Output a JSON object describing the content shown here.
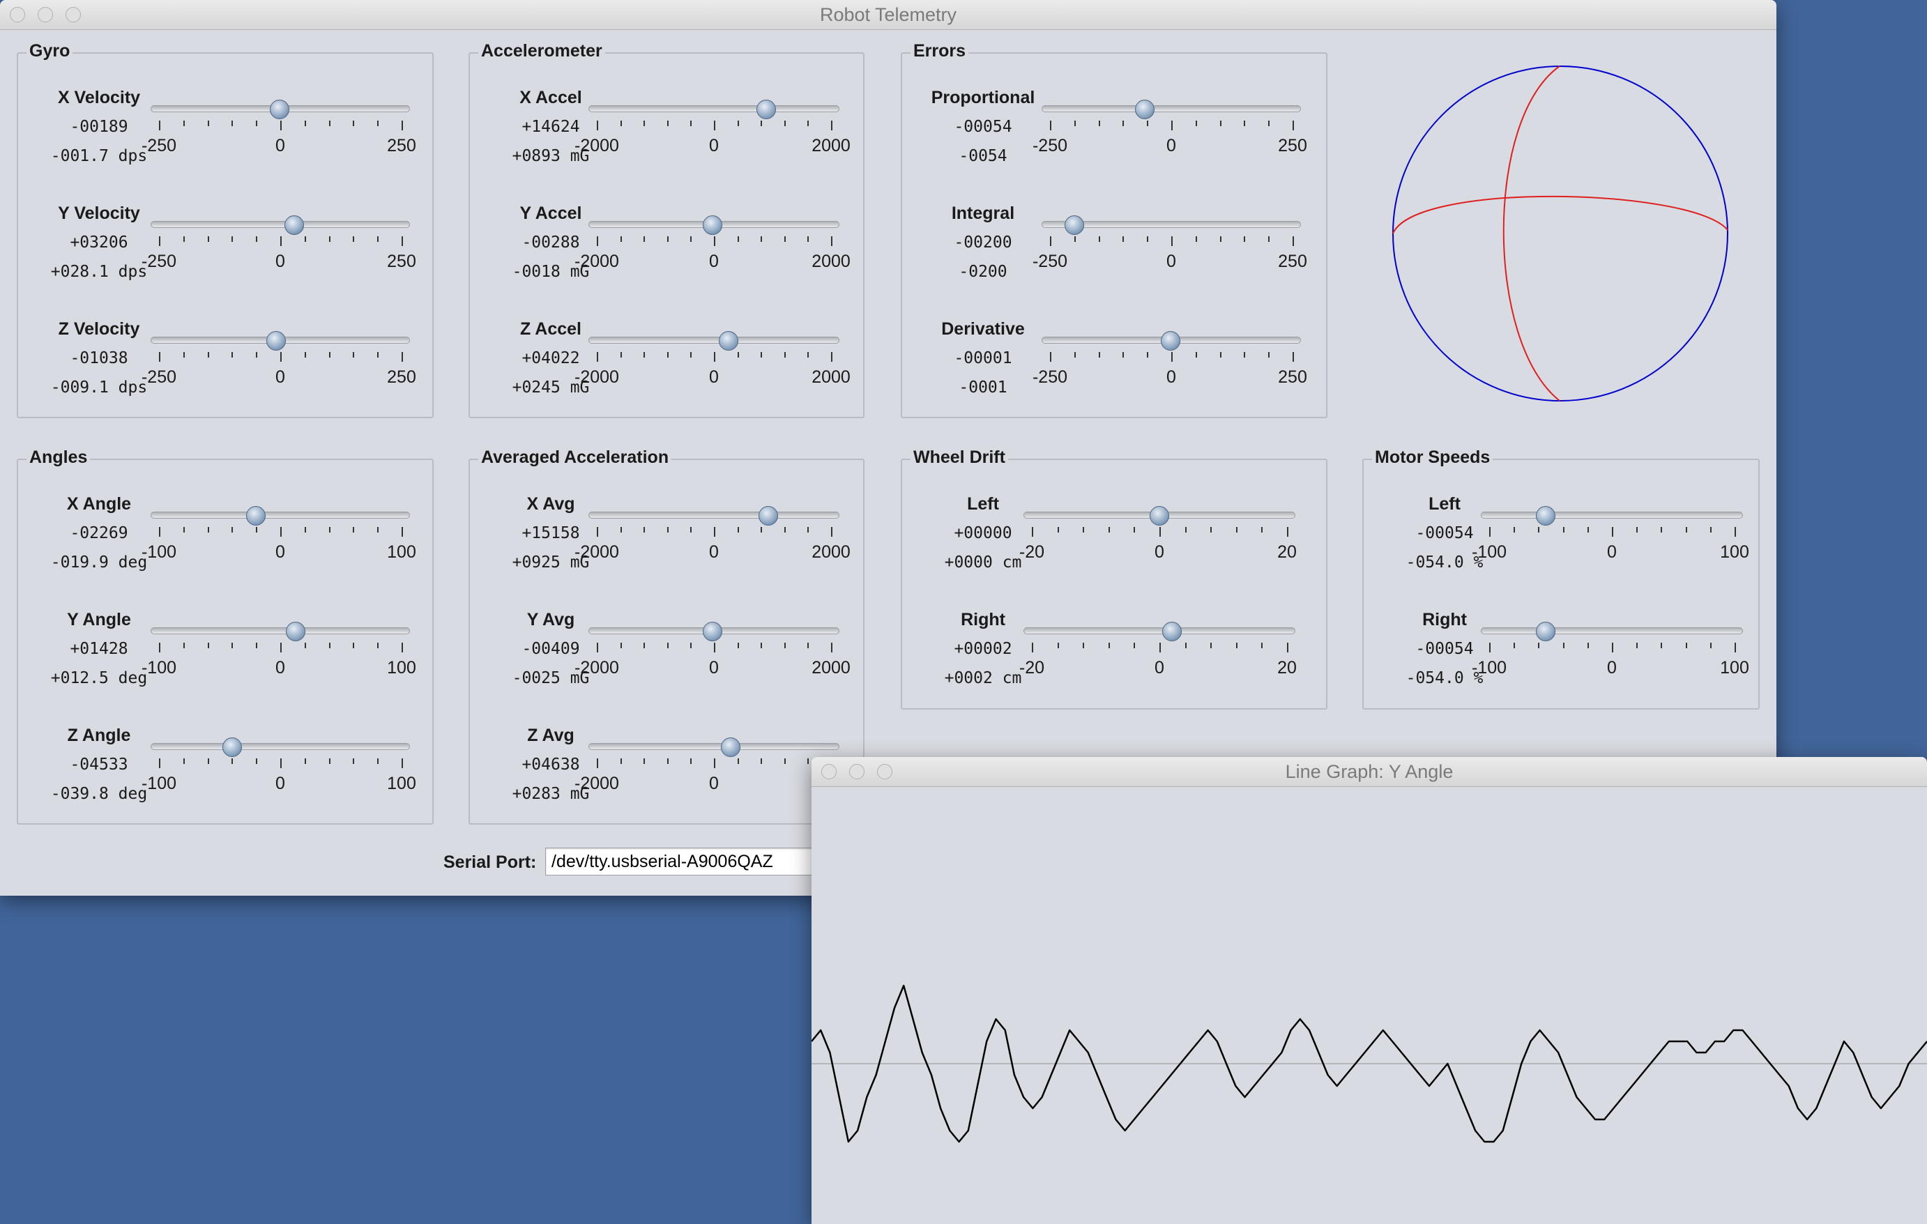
{
  "main_window": {
    "title": "Robot Telemetry",
    "serial_port_label": "Serial Port:",
    "serial_port_value": "/dev/tty.usbserial-A9006QAZ"
  },
  "graph_window": {
    "title": "Line Graph: Y Angle"
  },
  "panels": [
    {
      "title": "Gyro",
      "scale": [
        "-250",
        "0",
        "250"
      ],
      "min": -250,
      "max": 250,
      "rows": [
        {
          "label": "X Velocity",
          "raw": "-00189",
          "value": "-001.7 dps",
          "position": -1.7
        },
        {
          "label": "Y Velocity",
          "raw": "+03206",
          "value": "+028.1 dps",
          "position": 28.1
        },
        {
          "label": "Z Velocity",
          "raw": "-01038",
          "value": "-009.1 dps",
          "position": -9.1
        }
      ]
    },
    {
      "title": "Accelerometer",
      "scale": [
        "-2000",
        "0",
        "2000"
      ],
      "min": -2000,
      "max": 2000,
      "rows": [
        {
          "label": "X Accel",
          "raw": "+14624",
          "value": "+0893 mG",
          "position": 893
        },
        {
          "label": "Y Accel",
          "raw": "-00288",
          "value": "-0018 mG",
          "position": -18
        },
        {
          "label": "Z Accel",
          "raw": "+04022",
          "value": "+0245 mG",
          "position": 245
        }
      ]
    },
    {
      "title": "Errors",
      "scale": [
        "-250",
        "0",
        "250"
      ],
      "min": -250,
      "max": 250,
      "rows": [
        {
          "label": "Proportional",
          "raw": "-00054",
          "value": "-0054",
          "position": -54
        },
        {
          "label": "Integral",
          "raw": "-00200",
          "value": "-0200",
          "position": -200
        },
        {
          "label": "Derivative",
          "raw": "-00001",
          "value": "-0001",
          "position": -1
        }
      ]
    },
    {
      "title": "Angles",
      "scale": [
        "-100",
        "0",
        "100"
      ],
      "min": -100,
      "max": 100,
      "rows": [
        {
          "label": "X Angle",
          "raw": "-02269",
          "value": "-019.9 deg",
          "position": -19.9
        },
        {
          "label": "Y Angle",
          "raw": "+01428",
          "value": "+012.5 deg",
          "position": 12.5
        },
        {
          "label": "Z Angle",
          "raw": "-04533",
          "value": "-039.8 deg",
          "position": -39.8
        }
      ]
    },
    {
      "title": "Averaged Acceleration",
      "scale": [
        "-2000",
        "0",
        "2000"
      ],
      "min": -2000,
      "max": 2000,
      "rows": [
        {
          "label": "X Avg",
          "raw": "+15158",
          "value": "+0925 mG",
          "position": 925
        },
        {
          "label": "Y Avg",
          "raw": "-00409",
          "value": "-0025 mG",
          "position": -25
        },
        {
          "label": "Z Avg",
          "raw": "+04638",
          "value": "+0283 mG",
          "position": 283
        }
      ]
    },
    {
      "title": "Wheel Drift",
      "scale": [
        "-20",
        "0",
        "20"
      ],
      "min": -20,
      "max": 20,
      "rows": [
        {
          "label": "Left",
          "raw": "+00000",
          "value": "+0000 cm",
          "position": 0
        },
        {
          "label": "Right",
          "raw": "+00002",
          "value": "+0002 cm",
          "position": 2
        }
      ]
    },
    {
      "title": "Motor Speeds",
      "scale": [
        "-100",
        "0",
        "100"
      ],
      "min": -100,
      "max": 100,
      "rows": [
        {
          "label": "Left",
          "raw": "-00054",
          "value": "-054.0 %",
          "position": -54
        },
        {
          "label": "Right",
          "raw": "-00054",
          "value": "-054.0 %",
          "position": -54
        }
      ]
    }
  ],
  "colors": {
    "sphere_outline": "#0000d0",
    "sphere_lines": "#e02020",
    "graph_line": "#000000"
  },
  "chart_data": {
    "type": "line",
    "title": "Line Graph: Y Angle",
    "x": [
      0,
      1,
      2,
      3,
      4,
      5,
      6,
      7,
      8,
      9,
      10,
      11,
      12,
      13,
      14,
      15,
      16,
      17,
      18,
      19,
      20,
      21,
      22,
      23,
      24,
      25,
      26,
      27,
      28,
      29,
      30,
      31,
      32,
      33,
      34,
      35,
      36,
      37,
      38,
      39,
      40,
      41,
      42,
      43,
      44,
      45,
      46,
      47,
      48,
      49,
      50,
      51,
      52,
      53,
      54,
      55,
      56,
      57,
      58,
      59,
      60,
      61,
      62,
      63,
      64,
      65,
      66,
      67,
      68,
      69,
      70,
      71,
      72,
      73,
      74,
      75,
      76,
      77,
      78,
      79,
      80,
      81,
      82,
      83,
      84,
      85,
      86,
      87,
      88,
      89,
      90,
      91,
      92,
      93,
      94,
      95,
      96,
      97,
      98,
      99,
      100,
      101,
      102,
      103,
      104,
      105,
      106,
      107,
      108,
      109,
      110,
      111,
      112,
      113,
      114,
      115,
      116,
      117,
      118,
      119
    ],
    "values": [
      2,
      3,
      1,
      -3,
      -7,
      -6,
      -3,
      -1,
      2,
      5,
      7,
      4,
      1,
      -1,
      -4,
      -6,
      -7,
      -6,
      -2,
      2,
      4,
      3,
      -1,
      -3,
      -4,
      -3,
      -1,
      1,
      3,
      2,
      1,
      -1,
      -3,
      -5,
      -6,
      -5,
      -4,
      -3,
      -2,
      -1,
      0,
      1,
      2,
      3,
      2,
      0,
      -2,
      -3,
      -2,
      -1,
      0,
      1,
      3,
      4,
      3,
      1,
      -1,
      -2,
      -1,
      0,
      1,
      2,
      3,
      2,
      1,
      0,
      -1,
      -2,
      -1,
      0,
      -2,
      -4,
      -6,
      -7,
      -7,
      -6,
      -3,
      0,
      2,
      3,
      2,
      1,
      -1,
      -3,
      -4,
      -5,
      -5,
      -4,
      -3,
      -2,
      -1,
      0,
      1,
      2,
      2,
      2,
      1,
      1,
      2,
      2,
      3,
      3,
      2,
      1,
      0,
      -1,
      -2,
      -4,
      -5,
      -4,
      -2,
      0,
      2,
      1,
      -1,
      -3,
      -4,
      -3,
      -2,
      0,
      1,
      2
    ],
    "ylim": [
      -10,
      10
    ]
  }
}
